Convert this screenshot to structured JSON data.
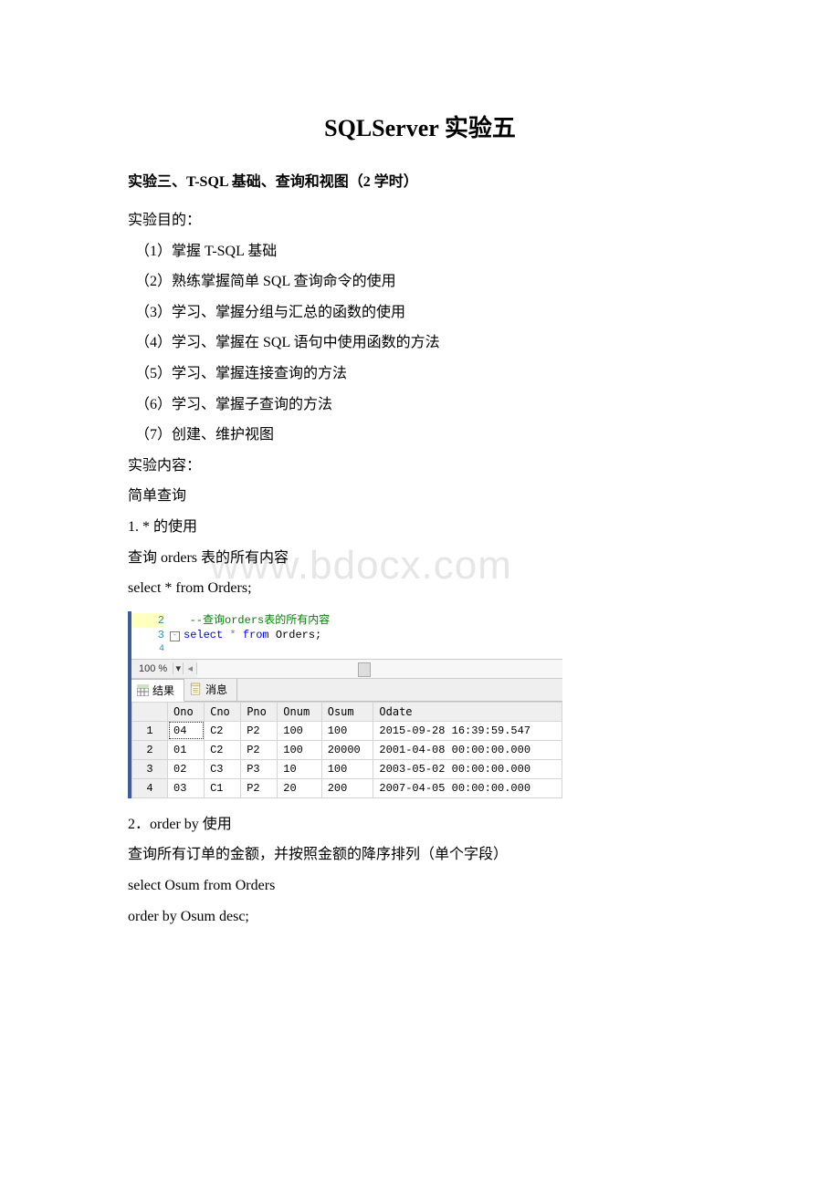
{
  "title_part1": "SQLServer ",
  "title_part2": "实验五",
  "subtitle_prefix": "实验三、",
  "subtitle_en": "T-SQL ",
  "subtitle_mid": "基础、查询和视图（",
  "subtitle_num": "2 ",
  "subtitle_suffix": "学时）",
  "line_purpose": "实验目的：",
  "obj1_a": "（1）掌握 ",
  "obj1_b": "T-SQL ",
  "obj1_c": "基础",
  "obj2_a": "（2）熟练掌握简单 ",
  "obj2_b": "SQL ",
  "obj2_c": "查询命令的使用",
  "obj3": "（3）学习、掌握分组与汇总的函数的使用",
  "obj4_a": "（4）学习、掌握在 ",
  "obj4_b": "SQL ",
  "obj4_c": "语句中使用函数的方法",
  "obj5": "（5）学习、掌握连接查询的方法",
  "obj6": "（6）学习、掌握子查询的方法",
  "obj7": "（7）创建、维护视图",
  "line_content": "实验内容：",
  "simple_query": "简单查询",
  "q1_a": "1. * ",
  "q1_b": "的使用",
  "q1_desc_a": "查询 ",
  "q1_desc_b": "orders ",
  "q1_desc_c": "表的所有内容",
  "q1_sql": "select * from Orders;",
  "watermark": "www.bdocx.com",
  "ssms": {
    "gutter": {
      "l2": "2",
      "l3": "3",
      "l4": "4"
    },
    "comment": "--查询orders表的所有内容",
    "sql_select": "select",
    "sql_star": " * ",
    "sql_from": "from",
    "sql_tail": " Orders;",
    "zoom": "100 %",
    "tab_results": "结果",
    "tab_messages": "消息",
    "headers": [
      "",
      "Ono",
      "Cno",
      "Pno",
      "Onum",
      "Osum",
      "Odate"
    ],
    "rows": [
      [
        "1",
        "04",
        "C2",
        "P2",
        "100",
        "100",
        "2015-09-28 16:39:59.547"
      ],
      [
        "2",
        "01",
        "C2",
        "P2",
        "100",
        "20000",
        "2001-04-08 00:00:00.000"
      ],
      [
        "3",
        "02",
        "C3",
        "P3",
        "10",
        "100",
        "2003-05-02 00:00:00.000"
      ],
      [
        "4",
        "03",
        "C1",
        "P2",
        "20",
        "200",
        "2007-04-05 00:00:00.000"
      ]
    ]
  },
  "q2_a": "2．",
  "q2_b": "order by ",
  "q2_c": "使用",
  "q2_desc": "查询所有订单的金额，并按照金额的降序排列（单个字段）",
  "q2_sql1": "select Osum from Orders",
  "q2_sql2": "order by Osum desc;"
}
